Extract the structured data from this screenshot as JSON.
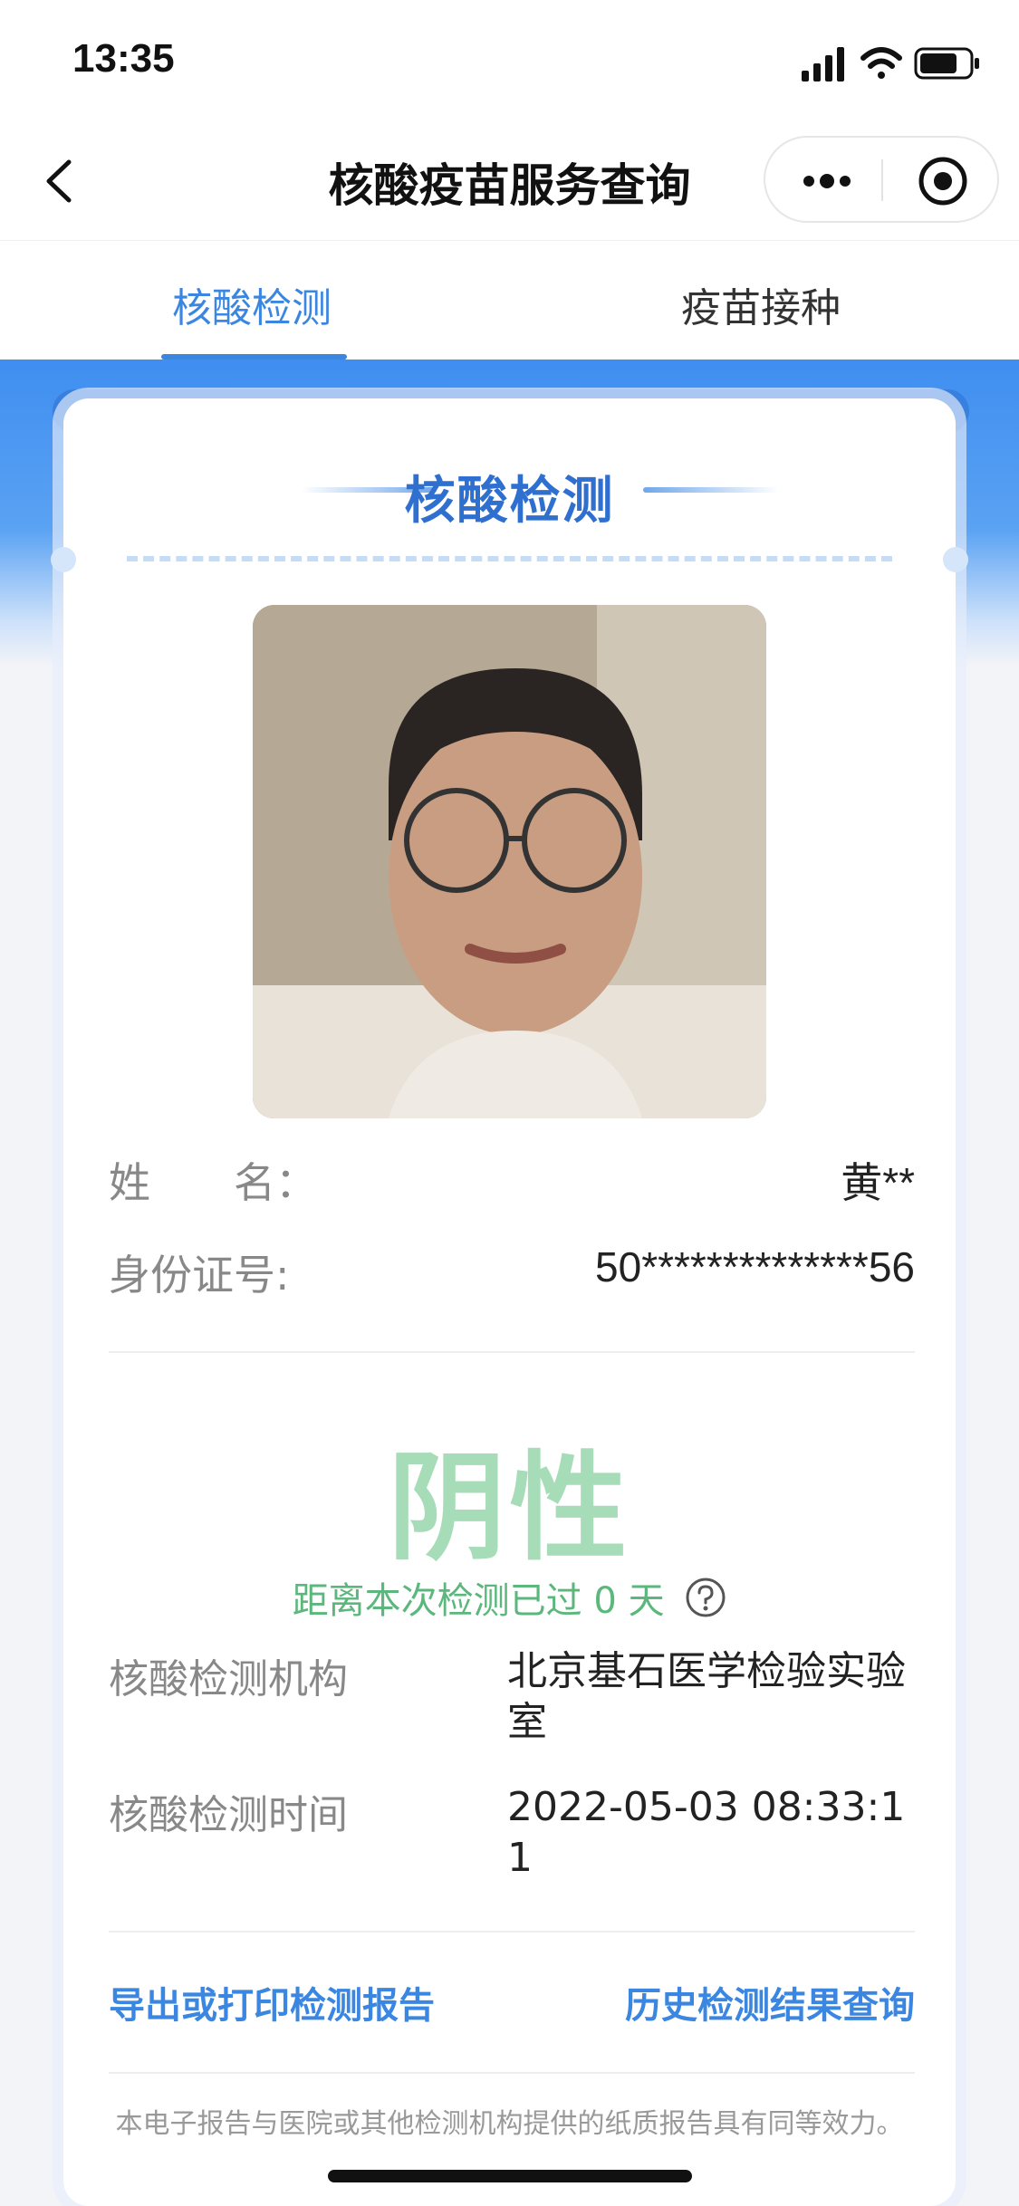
{
  "status_bar": {
    "time": "13:35"
  },
  "nav": {
    "title": "核酸疫苗服务查询"
  },
  "tabs": [
    {
      "label": "核酸检测",
      "active": true
    },
    {
      "label": "疫苗接种",
      "active": false
    }
  ],
  "card": {
    "title": "核酸检测",
    "name_label": "姓　　名：",
    "name_value": "黄**",
    "id_label": "身份证号:",
    "id_value": "50**************56",
    "result": "阴性",
    "days_text": "距离本次检测已过 0 天",
    "institution_label": "核酸检测机构",
    "institution_value": "北京基石医学检验实验室",
    "time_label": "核酸检测时间",
    "time_value": "2022-05-03 08:33:11",
    "export_link": "导出或打印检测报告",
    "history_link": "历史检测结果查询",
    "footer_note": "本电子报告与医院或其他检测机构提供的纸质报告具有同等效力。"
  },
  "colors": {
    "accent": "#3a86e0",
    "result_green": "#a6dcb7",
    "days_green": "#5bb77b"
  },
  "icons": [
    "back-icon",
    "more-icon",
    "target-icon",
    "help-icon",
    "signal-icon",
    "wifi-icon",
    "battery-icon"
  ]
}
